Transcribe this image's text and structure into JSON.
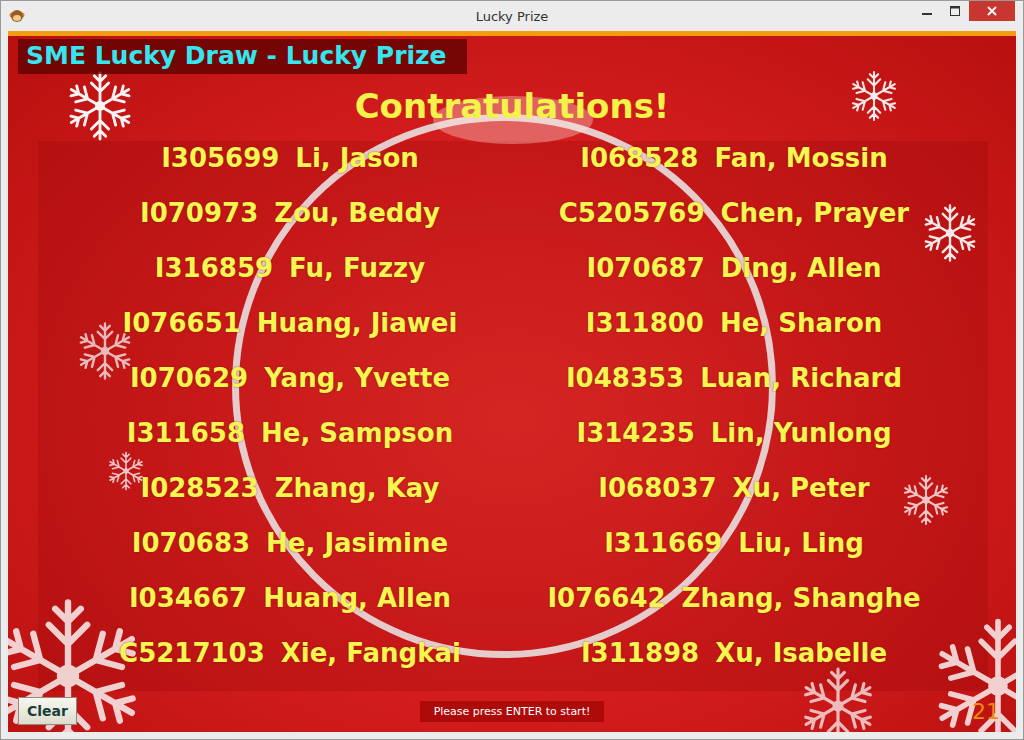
{
  "window": {
    "title": "Lucky Prize"
  },
  "header": {
    "title": "SME Lucky Draw - Lucky Prize"
  },
  "heading": "Contratulations!",
  "winners": [
    {
      "id": "I305699",
      "name": "Li, Jason"
    },
    {
      "id": "I068528",
      "name": "Fan, Mossin"
    },
    {
      "id": "I070973",
      "name": "Zou, Beddy"
    },
    {
      "id": "C5205769",
      "name": "Chen, Prayer"
    },
    {
      "id": "I316859",
      "name": "Fu, Fuzzy"
    },
    {
      "id": "I070687",
      "name": "Ding, Allen"
    },
    {
      "id": "I076651",
      "name": "Huang, Jiawei"
    },
    {
      "id": "I311800",
      "name": "He, Sharon"
    },
    {
      "id": "I070629",
      "name": "Yang, Yvette"
    },
    {
      "id": "I048353",
      "name": "Luan, Richard"
    },
    {
      "id": "I311658",
      "name": "He, Sampson"
    },
    {
      "id": "I314235",
      "name": "Lin, Yunlong"
    },
    {
      "id": "I028523",
      "name": "Zhang, Kay"
    },
    {
      "id": "I068037",
      "name": "Xu, Peter"
    },
    {
      "id": "I070683",
      "name": "He, Jasimine"
    },
    {
      "id": "I311669",
      "name": "Liu, Ling"
    },
    {
      "id": "I034667",
      "name": "Huang, Allen"
    },
    {
      "id": "I076642",
      "name": "Zhang, Shanghe"
    },
    {
      "id": "C5217103",
      "name": "Xie, Fangkai"
    },
    {
      "id": "I311898",
      "name": "Xu, Isabelle"
    }
  ],
  "footer": {
    "clear_button": "Clear",
    "status": "Please press ENTER to start!",
    "count": "21"
  }
}
